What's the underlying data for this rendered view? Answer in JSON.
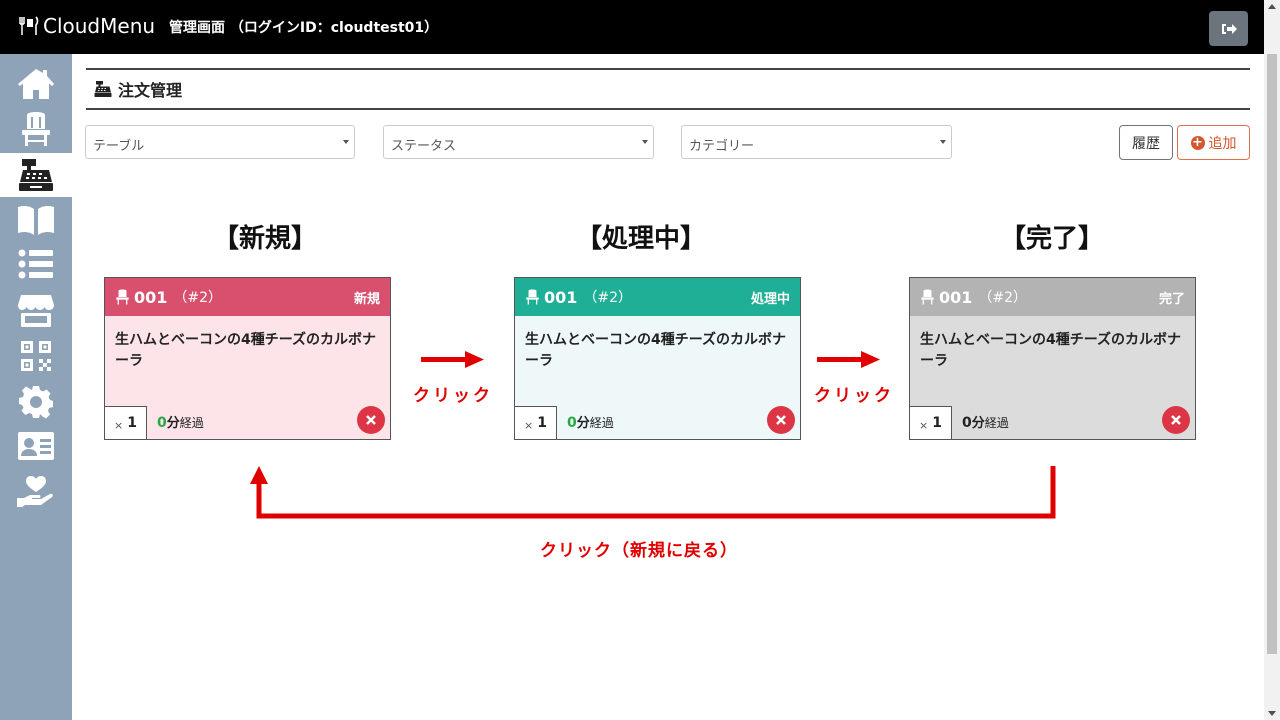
{
  "header": {
    "logo_text": "CloudMenu",
    "subtitle": "管理画面 （ログインID：cloudtest01）",
    "logout_icon": "sign-out-icon"
  },
  "sidebar": {
    "items": [
      {
        "icon": "home-icon",
        "active": false
      },
      {
        "icon": "chair-icon",
        "active": false
      },
      {
        "icon": "cash-register-icon",
        "active": true
      },
      {
        "icon": "book-icon",
        "active": false
      },
      {
        "icon": "list-icon",
        "active": false
      },
      {
        "icon": "store-icon",
        "active": false
      },
      {
        "icon": "qrcode-icon",
        "active": false
      },
      {
        "icon": "gear-icon",
        "active": false
      },
      {
        "icon": "id-card-icon",
        "active": false
      },
      {
        "icon": "hand-heart-icon",
        "active": false
      }
    ]
  },
  "page": {
    "title": "注文管理",
    "title_icon": "cash-register-icon"
  },
  "filters": {
    "table": "テーブル",
    "status": "ステータス",
    "category": "カテゴリー"
  },
  "buttons": {
    "history": "履歴",
    "add": "追加"
  },
  "diagram": {
    "headings": [
      "【新規】",
      "【処理中】",
      "【完了】"
    ],
    "click_label": "クリック",
    "click_back_label": "クリック（新規に戻る）"
  },
  "cards": [
    {
      "table_no": "001",
      "order_no": "（#2）",
      "status": "新規",
      "item": "生ハムとベーコンの4種チーズのカルボナーラ",
      "qty_x": "×",
      "qty": "1",
      "elapsed_num": "0",
      "elapsed_unit": "分",
      "elapsed_label": "経過",
      "head_color": "#d9506e",
      "body_color": "#fde4e9",
      "num_color": "#28a745"
    },
    {
      "table_no": "001",
      "order_no": "（#2）",
      "status": "処理中",
      "item": "生ハムとベーコンの4種チーズのカルボナーラ",
      "qty_x": "×",
      "qty": "1",
      "elapsed_num": "0",
      "elapsed_unit": "分",
      "elapsed_label": "経過",
      "head_color": "#1fae96",
      "body_color": "#eef8f8",
      "num_color": "#28a745"
    },
    {
      "table_no": "001",
      "order_no": "（#2）",
      "status": "完了",
      "item": "生ハムとベーコンの4種チーズのカルボナーラ",
      "qty_x": "×",
      "qty": "1",
      "elapsed_num": "0",
      "elapsed_unit": "分",
      "elapsed_label": "経過",
      "head_color": "#b3b3b3",
      "body_color": "#dcdcdc",
      "num_color": "#222222"
    }
  ],
  "colors": {
    "header_bg": "#000000",
    "sidebar_bg": "#8fa3b8",
    "arrow_red": "#e00000",
    "delete_red": "#dc3545",
    "add_orange": "#d4562c"
  }
}
